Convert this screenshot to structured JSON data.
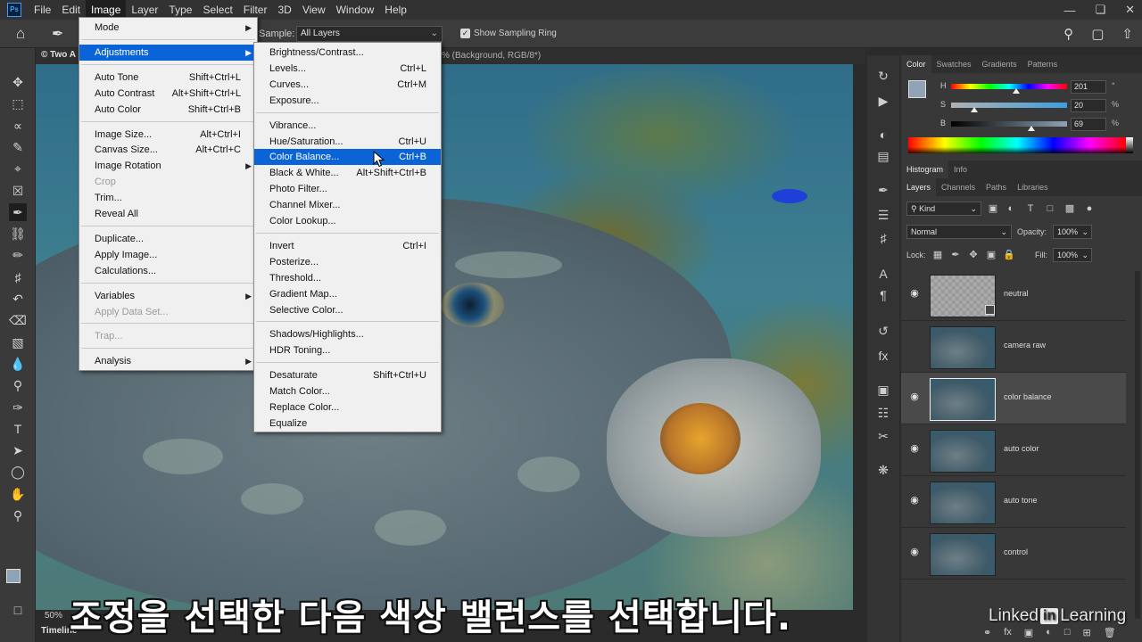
{
  "menubar": {
    "logo": "Ps",
    "items": [
      "File",
      "Edit",
      "Image",
      "Layer",
      "Type",
      "Select",
      "Filter",
      "3D",
      "View",
      "Window",
      "Help"
    ],
    "active": "Image"
  },
  "options": {
    "sample_label": "Sample:",
    "sample_value": "All Layers",
    "show_ring_label": "Show Sampling Ring",
    "show_ring_checked": true
  },
  "document": {
    "tab_left": "© Two A",
    "tab_right": "% (Background, RGB/8*)",
    "zoom": "50%",
    "timeline": "Timeline"
  },
  "image_menu": [
    {
      "label": "Mode",
      "submenu": true
    },
    {
      "sep": true
    },
    {
      "label": "Adjustments",
      "submenu": true,
      "highlighted": true
    },
    {
      "sep": true
    },
    {
      "label": "Auto Tone",
      "shortcut": "Shift+Ctrl+L"
    },
    {
      "label": "Auto Contrast",
      "shortcut": "Alt+Shift+Ctrl+L"
    },
    {
      "label": "Auto Color",
      "shortcut": "Shift+Ctrl+B"
    },
    {
      "sep": true
    },
    {
      "label": "Image Size...",
      "shortcut": "Alt+Ctrl+I"
    },
    {
      "label": "Canvas Size...",
      "shortcut": "Alt+Ctrl+C"
    },
    {
      "label": "Image Rotation",
      "submenu": true
    },
    {
      "label": "Crop",
      "disabled": true
    },
    {
      "label": "Trim..."
    },
    {
      "label": "Reveal All"
    },
    {
      "sep": true
    },
    {
      "label": "Duplicate..."
    },
    {
      "label": "Apply Image..."
    },
    {
      "label": "Calculations..."
    },
    {
      "sep": true
    },
    {
      "label": "Variables",
      "submenu": true
    },
    {
      "label": "Apply Data Set...",
      "disabled": true
    },
    {
      "sep": true
    },
    {
      "label": "Trap...",
      "disabled": true
    },
    {
      "sep": true
    },
    {
      "label": "Analysis",
      "submenu": true
    }
  ],
  "adjustments_menu": [
    {
      "label": "Brightness/Contrast..."
    },
    {
      "label": "Levels...",
      "shortcut": "Ctrl+L"
    },
    {
      "label": "Curves...",
      "shortcut": "Ctrl+M"
    },
    {
      "label": "Exposure..."
    },
    {
      "sep": true
    },
    {
      "label": "Vibrance..."
    },
    {
      "label": "Hue/Saturation...",
      "shortcut": "Ctrl+U"
    },
    {
      "label": "Color Balance...",
      "shortcut": "Ctrl+B",
      "highlighted": true
    },
    {
      "label": "Black & White...",
      "shortcut": "Alt+Shift+Ctrl+B"
    },
    {
      "label": "Photo Filter..."
    },
    {
      "label": "Channel Mixer..."
    },
    {
      "label": "Color Lookup..."
    },
    {
      "sep": true
    },
    {
      "label": "Invert",
      "shortcut": "Ctrl+I"
    },
    {
      "label": "Posterize..."
    },
    {
      "label": "Threshold..."
    },
    {
      "label": "Gradient Map..."
    },
    {
      "label": "Selective Color..."
    },
    {
      "sep": true
    },
    {
      "label": "Shadows/Highlights..."
    },
    {
      "label": "HDR Toning..."
    },
    {
      "sep": true
    },
    {
      "label": "Desaturate",
      "shortcut": "Shift+Ctrl+U"
    },
    {
      "label": "Match Color..."
    },
    {
      "label": "Replace Color..."
    },
    {
      "label": "Equalize"
    }
  ],
  "color_panel": {
    "tabs": [
      "Color",
      "Swatches",
      "Gradients",
      "Patterns"
    ],
    "active_tab": "Color",
    "swatch": "#8fa3b6",
    "hsb": [
      {
        "label": "H",
        "value": "201",
        "unit": "°",
        "fraction": 0.56
      },
      {
        "label": "S",
        "value": "20",
        "unit": "%",
        "fraction": 0.2
      },
      {
        "label": "B",
        "value": "69",
        "unit": "%",
        "fraction": 0.69
      }
    ]
  },
  "histogram_tabs": [
    "Histogram",
    "Info"
  ],
  "layers_panel": {
    "tabs": [
      "Layers",
      "Channels",
      "Paths",
      "Libraries"
    ],
    "filter_kind": "Kind",
    "blend_mode": "Normal",
    "opacity_label": "Opacity:",
    "opacity": "100%",
    "lock_label": "Lock:",
    "fill_label": "Fill:",
    "fill": "100%",
    "layers": [
      {
        "name": "neutral",
        "visible": true,
        "selected": false,
        "empty": true
      },
      {
        "name": "camera raw",
        "visible": false,
        "selected": false
      },
      {
        "name": "color balance",
        "visible": true,
        "selected": true
      },
      {
        "name": "auto color",
        "visible": true,
        "selected": false
      },
      {
        "name": "auto tone",
        "visible": true,
        "selected": false
      },
      {
        "name": "control",
        "visible": true,
        "selected": false
      }
    ]
  },
  "subtitle": "조정을 선택한 다음 색상 밸런스를 선택합니다.",
  "watermark": {
    "pre": "Linked",
    "mark": "in",
    "post": "Learning"
  }
}
